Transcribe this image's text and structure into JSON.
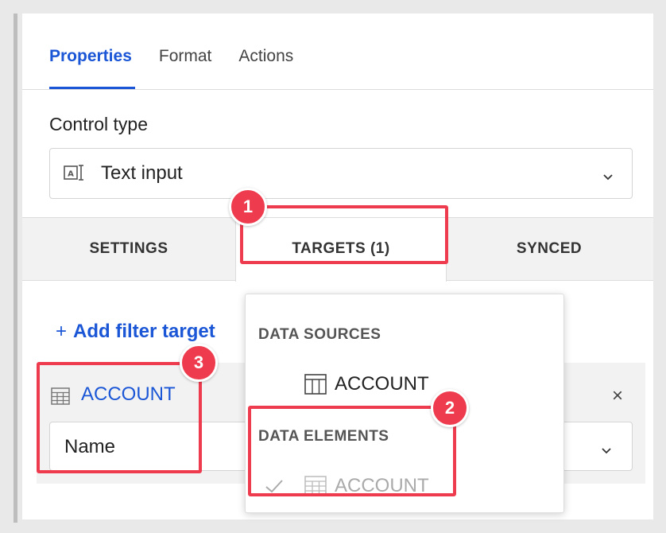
{
  "tabs": [
    {
      "label": "Properties",
      "active": true
    },
    {
      "label": "Format",
      "active": false
    },
    {
      "label": "Actions",
      "active": false
    }
  ],
  "control_type": {
    "label": "Control type",
    "value": "Text input",
    "icon": "text-input-icon"
  },
  "subtabs": [
    {
      "label": "SETTINGS",
      "active": false
    },
    {
      "label": "TARGETS (1)",
      "active": true
    },
    {
      "label": "SYNCED",
      "active": false
    }
  ],
  "add_filter_target": {
    "icon": "+",
    "label": "Add filter target"
  },
  "target_card": {
    "source_name": "ACCOUNT",
    "field_value": "Name",
    "close_icon": "×"
  },
  "dropdown": {
    "sections": [
      {
        "header": "DATA SOURCES",
        "items": [
          {
            "label": "ACCOUNT",
            "icon": "table-icon",
            "disabled": false
          }
        ]
      },
      {
        "header": "DATA ELEMENTS",
        "items": [
          {
            "label": "ACCOUNT",
            "icon": "table-icon",
            "disabled": true,
            "checked": true
          }
        ]
      }
    ]
  },
  "annotations": [
    {
      "number": "1"
    },
    {
      "number": "2"
    },
    {
      "number": "3"
    }
  ],
  "colors": {
    "accent": "#1a56d6",
    "annotation": "#ee3b4e",
    "panel_bg": "#ffffff",
    "page_bg": "#e9e9e9"
  }
}
